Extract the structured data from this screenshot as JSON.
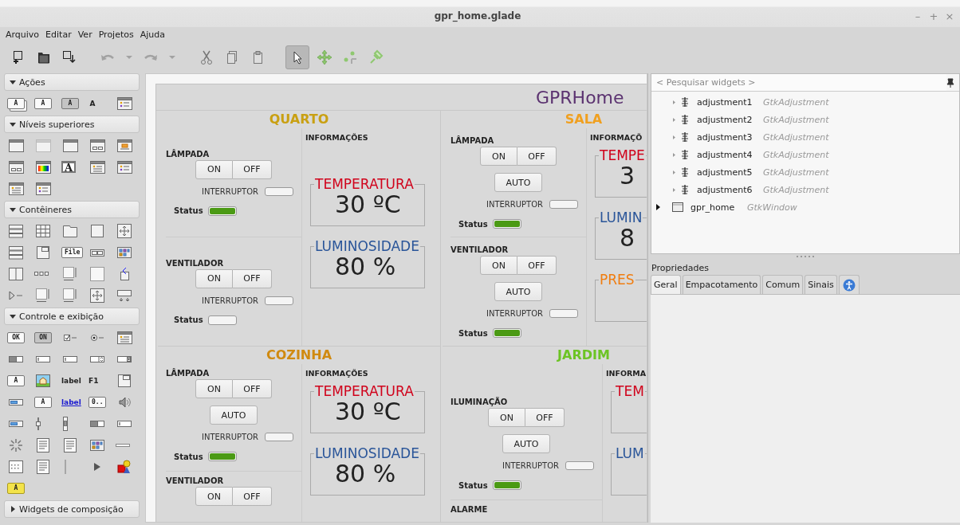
{
  "window": {
    "title": "gpr_home.glade",
    "controls": [
      "–",
      "+",
      "×"
    ]
  },
  "menu": [
    "Arquivo",
    "Editar",
    "Ver",
    "Projetos",
    "Ajuda"
  ],
  "toolbar": [
    {
      "kind": "new",
      "disabled": false,
      "selected": false
    },
    {
      "kind": "open",
      "disabled": false,
      "selected": false
    },
    {
      "kind": "save",
      "disabled": false,
      "selected": false
    },
    {
      "kind": "undo",
      "disabled": true,
      "selected": false
    },
    {
      "kind": "dropdown",
      "disabled": true,
      "selected": false
    },
    {
      "kind": "redo",
      "disabled": true,
      "selected": false
    },
    {
      "kind": "dropdown",
      "disabled": true,
      "selected": false
    },
    {
      "kind": "cut",
      "disabled": false,
      "selected": false
    },
    {
      "kind": "copy",
      "disabled": false,
      "selected": false
    },
    {
      "kind": "paste",
      "disabled": false,
      "selected": false
    },
    {
      "kind": "pointer",
      "disabled": false,
      "selected": true
    },
    {
      "kind": "drag",
      "disabled": false,
      "selected": false
    },
    {
      "kind": "margin",
      "disabled": false,
      "selected": false
    },
    {
      "kind": "pin",
      "disabled": false,
      "selected": false
    }
  ],
  "palette": [
    {
      "label": "Ações",
      "expanded": true,
      "items": [
        {
          "kind": "chip-stack",
          "text": "A"
        },
        {
          "kind": "chip",
          "text": "A"
        },
        {
          "kind": "chip-dark",
          "text": "A"
        },
        {
          "kind": "radio",
          "text": "A"
        },
        {
          "kind": "win-list"
        }
      ]
    },
    {
      "label": "Níveis superiores",
      "expanded": true,
      "items": [
        {
          "kind": "win"
        },
        {
          "kind": "win-faded"
        },
        {
          "kind": "win"
        },
        {
          "kind": "win-buttons"
        },
        {
          "kind": "win-orange"
        },
        {
          "kind": "win-buttons"
        },
        {
          "kind": "win-colors"
        },
        {
          "kind": "win-letter",
          "text": "A"
        },
        {
          "kind": "win-doc"
        },
        {
          "kind": "win-list"
        },
        {
          "kind": "win-doc"
        },
        {
          "kind": "win-list"
        }
      ]
    },
    {
      "label": "Contêineres",
      "expanded": true,
      "items": [
        {
          "kind": "box-v"
        },
        {
          "kind": "grid"
        },
        {
          "kind": "notebook"
        },
        {
          "kind": "frame"
        },
        {
          "kind": "fixed"
        },
        {
          "kind": "box-v"
        },
        {
          "kind": "frame-corner"
        },
        {
          "kind": "chip",
          "text": "File"
        },
        {
          "kind": "two-boxes"
        },
        {
          "kind": "colors"
        },
        {
          "kind": "paned"
        },
        {
          "kind": "dots3"
        },
        {
          "kind": "scroll"
        },
        {
          "kind": "dotted"
        },
        {
          "kind": "stack"
        },
        {
          "kind": "expander"
        },
        {
          "kind": "scroll"
        },
        {
          "kind": "scroll"
        },
        {
          "kind": "fixed"
        },
        {
          "kind": "frame-down"
        }
      ]
    },
    {
      "label": "Controle e exibição",
      "expanded": true,
      "items": [
        {
          "kind": "chip",
          "text": "OK"
        },
        {
          "kind": "chip-dark",
          "text": "ON"
        },
        {
          "kind": "check"
        },
        {
          "kind": "radio-line"
        },
        {
          "kind": "win-doc"
        },
        {
          "kind": "switch"
        },
        {
          "kind": "entry"
        },
        {
          "kind": "entry"
        },
        {
          "kind": "spin"
        },
        {
          "kind": "combo"
        },
        {
          "kind": "chip",
          "text": "A"
        },
        {
          "kind": "image"
        },
        {
          "kind": "text-bold",
          "text": "label"
        },
        {
          "kind": "text-bold",
          "text": "F1"
        },
        {
          "kind": "frame-corner"
        },
        {
          "kind": "progress"
        },
        {
          "kind": "chip",
          "text": "A"
        },
        {
          "kind": "link",
          "text": "label"
        },
        {
          "kind": "chip",
          "text": "0.."
        },
        {
          "kind": "volume"
        },
        {
          "kind": "progress"
        },
        {
          "kind": "slider-v"
        },
        {
          "kind": "scrollbar-v"
        },
        {
          "kind": "switch"
        },
        {
          "kind": "entry"
        },
        {
          "kind": "spinner"
        },
        {
          "kind": "textview"
        },
        {
          "kind": "textview"
        },
        {
          "kind": "colors"
        },
        {
          "kind": "separator"
        },
        {
          "kind": "calendar"
        },
        {
          "kind": "textview"
        },
        {
          "kind": "vline"
        },
        {
          "kind": "play"
        },
        {
          "kind": "shapes"
        },
        {
          "kind": "chip-yellow",
          "text": "A"
        }
      ]
    },
    {
      "label": "Widgets de composição",
      "expanded": false
    }
  ],
  "app": {
    "title": "GPRHome",
    "rooms": [
      {
        "title": "QUARTO",
        "color": "#c9a012",
        "devices": [
          {
            "title": "LÂMPADA",
            "buttons": [
              "ON",
              "OFF"
            ],
            "switch_label": "INTERRUPTOR",
            "switch_on": false,
            "status_label": "Status",
            "status_on": true
          },
          {
            "title": "VENTILADOR",
            "buttons": [
              "ON",
              "OFF"
            ],
            "switch_label": "INTERRUPTOR",
            "switch_on": false,
            "status_label": "Status",
            "status_on": false
          }
        ],
        "info": {
          "title": "INFORMAÇÕES",
          "frames": [
            {
              "legend": "TEMPERATURA",
              "color": "#d0021b",
              "value": "30 ºC"
            },
            {
              "legend": "LUMINOSIDADE",
              "color": "#2a5599",
              "value": "80 %"
            }
          ]
        }
      },
      {
        "title": "SALA",
        "color": "#f0a020",
        "devices": [
          {
            "title": "LÂMPADA",
            "buttons": [
              "ON",
              "OFF"
            ],
            "auto": "AUTO",
            "switch_label": "INTERRUPTOR",
            "switch_on": false,
            "status_label": "Status",
            "status_on": true
          },
          {
            "title": "VENTILADOR",
            "buttons": [
              "ON",
              "OFF"
            ],
            "auto": "AUTO",
            "switch_label": "INTERRUPTOR",
            "switch_on": false,
            "status_label": "Status",
            "status_on": true
          }
        ],
        "info": {
          "title": "INFORMAÇÕ",
          "frames": [
            {
              "legend": "TEMPE",
              "color": "#d0021b",
              "value": "3"
            },
            {
              "legend": "LUMIN",
              "color": "#2a5599",
              "value": "8"
            },
            {
              "legend": "PRES",
              "color": "#f07d10"
            }
          ]
        }
      },
      {
        "title": "COZINHA",
        "color": "#d08a10",
        "devices": [
          {
            "title": "LÂMPADA",
            "buttons": [
              "ON",
              "OFF"
            ],
            "auto": "AUTO",
            "switch_label": "INTERRUPTOR",
            "switch_on": false,
            "status_label": "Status",
            "status_on": true
          },
          {
            "title": "VENTILADOR",
            "buttons": [
              "ON",
              "OFF"
            ]
          }
        ],
        "info": {
          "title": "INFORMAÇÕES",
          "frames": [
            {
              "legend": "TEMPERATURA",
              "color": "#d0021b",
              "value": "30 ºC"
            },
            {
              "legend": "LUMINOSIDADE",
              "color": "#2a5599",
              "value": "80 %"
            }
          ]
        }
      },
      {
        "title": "JARDIM",
        "color": "#6cc424",
        "devices": [
          {
            "title": "ILUMINAÇÃO",
            "buttons": [
              "ON",
              "OFF"
            ],
            "auto": "AUTO",
            "switch_label": "INTERRUPTOR",
            "switch_on": false,
            "status_label": "Status",
            "status_on": true
          },
          {
            "title": "ALARME"
          }
        ],
        "info": {
          "title": "INFORMA",
          "frames": [
            {
              "legend": "TEM",
              "color": "#d0021b"
            },
            {
              "legend": "LUM",
              "color": "#2a5599"
            }
          ]
        }
      }
    ]
  },
  "inspector": {
    "search": {
      "placeholder": "< Pesquisar widgets >"
    },
    "tree": [
      {
        "kind": "adjustment",
        "name": "adjustment1",
        "type": "GtkAdjustment",
        "expanded": false
      },
      {
        "kind": "adjustment",
        "name": "adjustment2",
        "type": "GtkAdjustment",
        "expanded": false
      },
      {
        "kind": "adjustment",
        "name": "adjustment3",
        "type": "GtkAdjustment",
        "expanded": false
      },
      {
        "kind": "adjustment",
        "name": "adjustment4",
        "type": "GtkAdjustment",
        "expanded": false
      },
      {
        "kind": "adjustment",
        "name": "adjustment5",
        "type": "GtkAdjustment",
        "expanded": false
      },
      {
        "kind": "adjustment",
        "name": "adjustment6",
        "type": "GtkAdjustment",
        "expanded": false
      },
      {
        "kind": "window",
        "name": "gpr_home",
        "type": "GtkWindow",
        "expanded": false
      }
    ],
    "properties_label": "Propriedades",
    "tabs": [
      {
        "kind": "text",
        "label": "Geral",
        "selected": true
      },
      {
        "kind": "text",
        "label": "Empacotamento",
        "selected": false
      },
      {
        "kind": "text",
        "label": "Comum",
        "selected": false
      },
      {
        "kind": "text",
        "label": "Sinais",
        "selected": false
      },
      {
        "kind": "accessibility",
        "selected": false
      }
    ]
  }
}
